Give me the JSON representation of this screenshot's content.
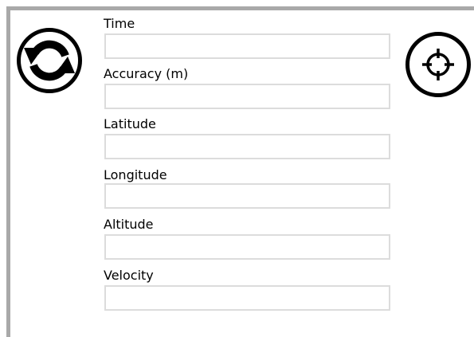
{
  "fields": [
    {
      "label": "Time",
      "value": ""
    },
    {
      "label": "Accuracy (m)",
      "value": ""
    },
    {
      "label": "Latitude",
      "value": ""
    },
    {
      "label": "Longitude",
      "value": ""
    },
    {
      "label": "Altitude",
      "value": ""
    },
    {
      "label": "Velocity",
      "value": ""
    }
  ],
  "icons": {
    "refresh": "refresh-icon",
    "locate": "crosshair-icon"
  },
  "colors": {
    "frame": "#a9a9a9",
    "input_border": "#dcdcdc"
  }
}
